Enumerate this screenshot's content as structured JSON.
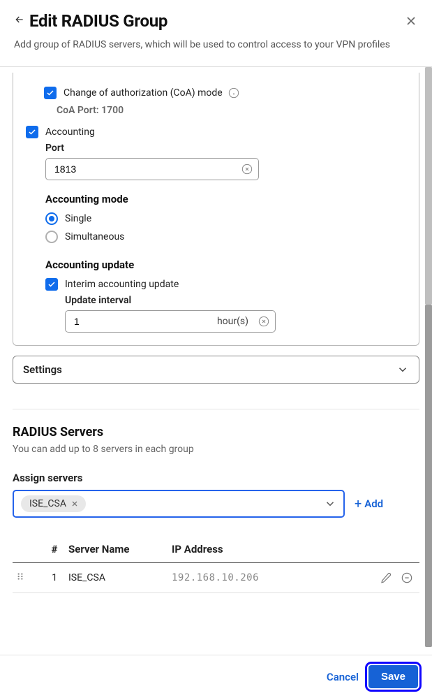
{
  "header": {
    "title": "Edit RADIUS Group",
    "subtitle": "Add group of RADIUS servers, which will be used to control access to your VPN profiles"
  },
  "config": {
    "coa_label": "Change of authorization (CoA) mode",
    "coa_port_label": "CoA Port: 1700",
    "accounting_label": "Accounting",
    "port_label": "Port",
    "port_value": "1813",
    "mode_label": "Accounting mode",
    "mode_single": "Single",
    "mode_simultaneous": "Simultaneous",
    "update_label": "Accounting update",
    "interim_label": "Interim accounting update",
    "interval_label": "Update interval",
    "interval_value": "1",
    "interval_unit": "hour(s)"
  },
  "settings_bar": {
    "label": "Settings"
  },
  "servers": {
    "heading": "RADIUS Servers",
    "sub": "You can add up to 8 servers in each group",
    "assign_label": "Assign servers",
    "chip": "ISE_CSA",
    "add_label": "Add",
    "columns": {
      "idx": "#",
      "name": "Server Name",
      "ip": "IP Address"
    },
    "rows": [
      {
        "idx": "1",
        "name": "ISE_CSA",
        "ip": "192.168.10.206"
      }
    ]
  },
  "footer": {
    "cancel": "Cancel",
    "save": "Save"
  }
}
